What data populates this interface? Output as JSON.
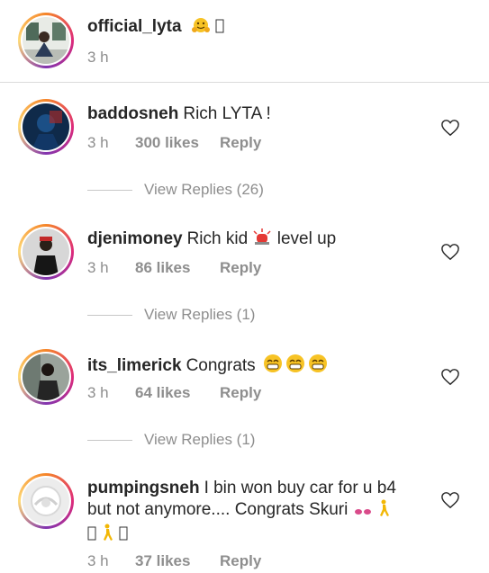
{
  "caption": {
    "username": "official_lyta",
    "time": "3 h"
  },
  "comments": [
    {
      "username": "baddosneh",
      "text": "Rich LYTA !",
      "time": "3 h",
      "likes": "300 likes",
      "reply": "Reply",
      "view_replies": "View Replies (26)"
    },
    {
      "username": "djenimoney",
      "text_before": "Rich kid",
      "text_after": "level up",
      "time": "3 h",
      "likes": "86 likes",
      "reply": "Reply",
      "view_replies": "View Replies (1)"
    },
    {
      "username": "its_limerick",
      "text": "Congrats",
      "time": "3 h",
      "likes": "64 likes",
      "reply": "Reply",
      "view_replies": "View Replies (1)"
    },
    {
      "username": "pumpingsneh",
      "text_line1": "I bin won buy car for u b4",
      "text_line2": "but not anymore.... Congrats Skuri",
      "time": "3 h",
      "likes": "37 likes",
      "reply": "Reply"
    }
  ],
  "icons": {
    "heart": "heart-outline-icon",
    "accent_ring": "#dd2a7b"
  }
}
